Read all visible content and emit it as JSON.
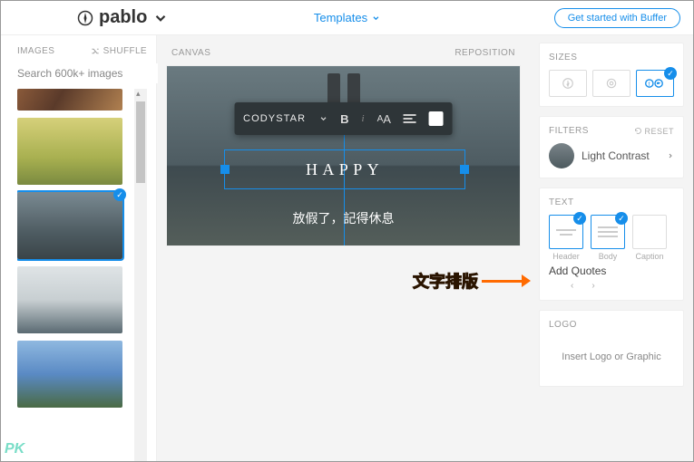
{
  "header": {
    "logo_text": "pablo",
    "templates_label": "Templates",
    "cta_label": "Get started with Buffer"
  },
  "left": {
    "title": "IMAGES",
    "shuffle_label": "SHUFFLE",
    "search_placeholder": "Search 600k+ images"
  },
  "center": {
    "canvas_label": "CANVAS",
    "reposition_label": "REPOSITION",
    "toolbar_font": "CODYSTAR",
    "headline": "HAPPY",
    "body_text": "放假了，記得休息"
  },
  "right": {
    "sizes_title": "SIZES",
    "filters_title": "FILTERS",
    "reset_label": "RESET",
    "filter_name": "Light Contrast",
    "text_title": "TEXT",
    "text_opts": {
      "header": "Header",
      "body": "Body",
      "caption": "Caption"
    },
    "add_quotes": "Add Quotes",
    "pager_left": "‹",
    "pager_right": "›",
    "logo_title": "LOGO",
    "logo_cta": "Insert Logo or Graphic"
  },
  "annotation": "文字排版",
  "watermark": "PK"
}
